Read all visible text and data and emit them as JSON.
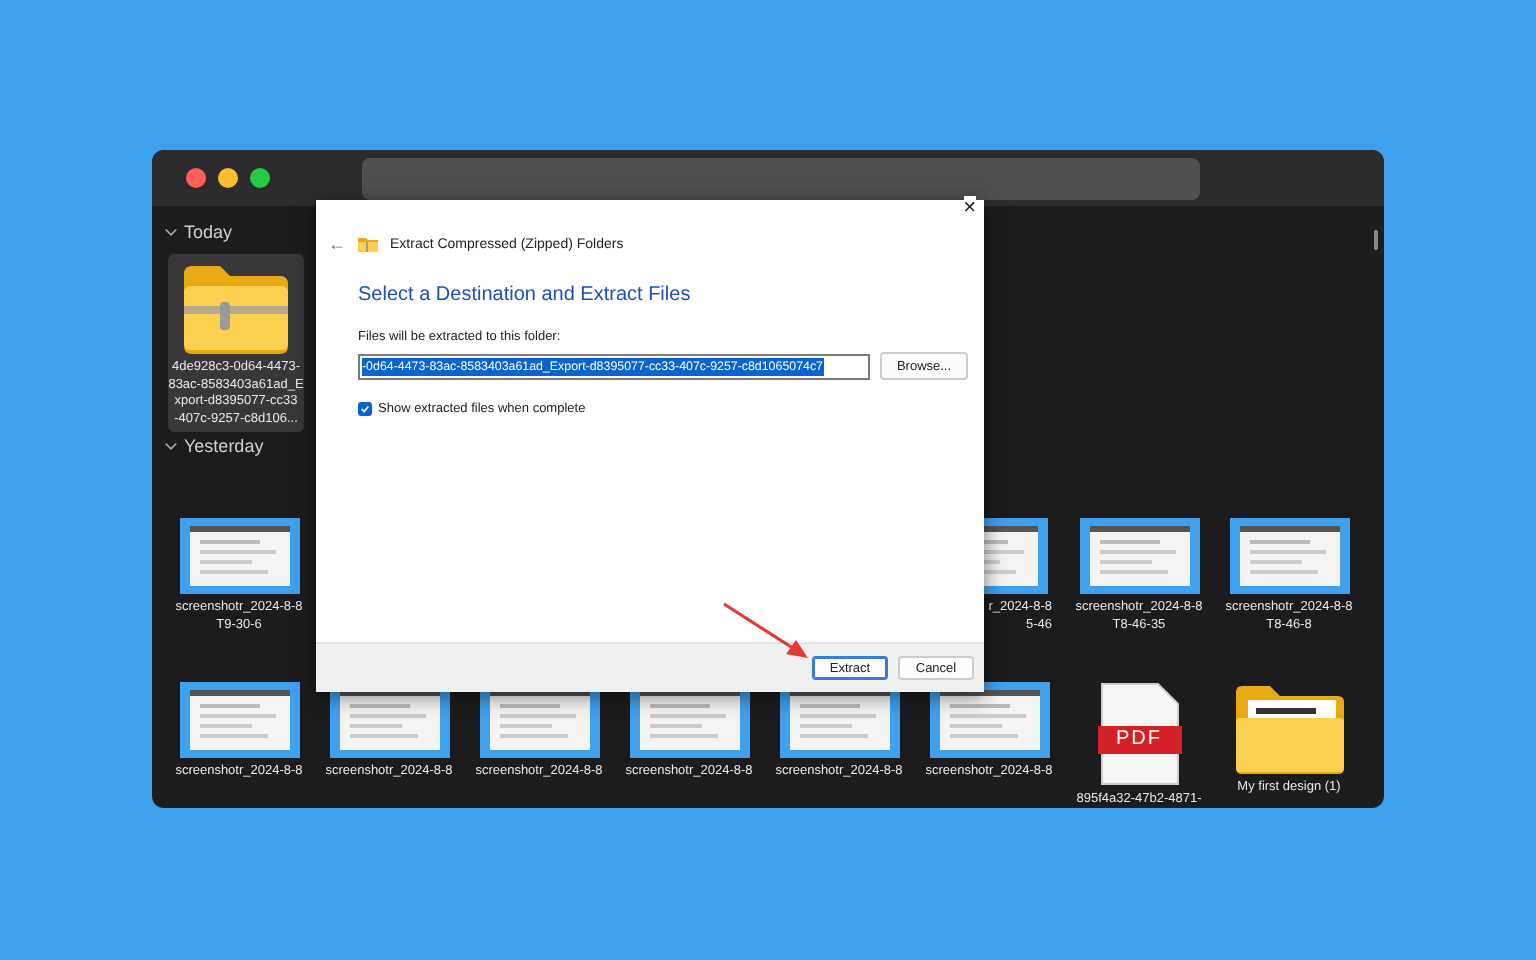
{
  "window": {
    "buttons": [
      {
        "kind": "close"
      },
      {
        "kind": "minimize"
      },
      {
        "kind": "zoom"
      }
    ]
  },
  "sections": [
    {
      "title": "Today",
      "expanded": true,
      "rows": [
        [
          {
            "kind": "zip",
            "selected": true,
            "label_lines": [
              "4de928c3-0d64-4473-",
              "83ac-8583403a61ad_E",
              "xport-d8395077-cc33",
              "-407c-9257-c8d106..."
            ]
          }
        ]
      ]
    },
    {
      "title": "Yesterday",
      "expanded": true,
      "rows": [
        [
          {
            "kind": "screenshot",
            "selected": false,
            "label_lines": [
              "screenshotr_2024-8-8",
              "T9-30-6"
            ]
          },
          {
            "kind": "hidden"
          },
          {
            "kind": "hidden"
          },
          {
            "kind": "hidden"
          },
          {
            "kind": "hidden"
          },
          {
            "kind": "screenshot",
            "selected": false,
            "covered": true,
            "label_lines": [
              "r_2024-8-8",
              "5-46"
            ]
          },
          {
            "kind": "screenshot",
            "selected": false,
            "label_lines": [
              "screenshotr_2024-8-8",
              "T8-46-35"
            ]
          },
          {
            "kind": "screenshot",
            "selected": false,
            "label_lines": [
              "screenshotr_2024-8-8",
              "T8-46-8"
            ]
          }
        ],
        [
          {
            "kind": "screenshot",
            "selected": false,
            "label_lines": [
              "screenshotr_2024-8-8"
            ]
          },
          {
            "kind": "screenshot",
            "selected": false,
            "label_lines": [
              "screenshotr_2024-8-8"
            ]
          },
          {
            "kind": "screenshot",
            "selected": false,
            "label_lines": [
              "screenshotr_2024-8-8"
            ]
          },
          {
            "kind": "screenshot",
            "selected": false,
            "label_lines": [
              "screenshotr_2024-8-8"
            ]
          },
          {
            "kind": "screenshot",
            "selected": false,
            "label_lines": [
              "screenshotr_2024-8-8"
            ]
          },
          {
            "kind": "screenshot",
            "selected": false,
            "label_lines": [
              "screenshotr_2024-8-8"
            ]
          },
          {
            "kind": "pdf",
            "selected": false,
            "badge": "PDF",
            "label_lines": [
              "895f4a32-47b2-4871-"
            ]
          },
          {
            "kind": "folder",
            "selected": false,
            "label_lines": [
              "My first design (1)"
            ]
          }
        ]
      ]
    }
  ],
  "dialog": {
    "close": "×",
    "back": "←",
    "title": "Extract Compressed (Zipped) Folders",
    "heading": "Select a Destination and Extract Files",
    "field_label": "Files will be extracted to this folder:",
    "path": "-0d64-4473-83ac-8583403a61ad_Export-d8395077-cc33-407c-9257-c8d1065074c7",
    "browse": "Browse...",
    "show_files": {
      "label": "Show extracted files when complete",
      "checked": true
    },
    "buttons": [
      {
        "label": "Extract",
        "kind": "default"
      },
      {
        "label": "Cancel",
        "kind": "normal"
      }
    ]
  }
}
